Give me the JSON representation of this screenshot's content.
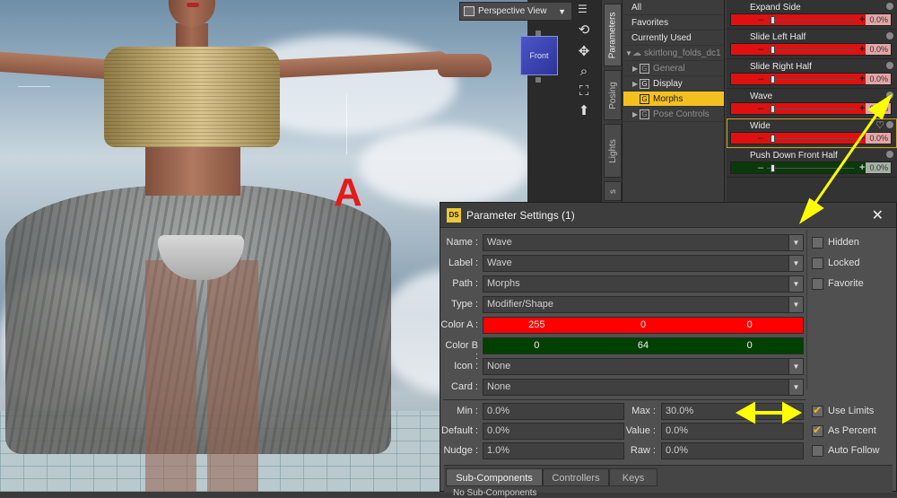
{
  "viewport": {
    "view_label": "Perspective View",
    "cube_label": "Front",
    "annotation_letter": "A"
  },
  "tabs": [
    "Parameters",
    "Posing",
    "Lights",
    "s"
  ],
  "tree": {
    "items": [
      {
        "label": "All"
      },
      {
        "label": "Favorites"
      },
      {
        "label": "Currently Used"
      },
      {
        "label": "skirtlong_folds_dc1"
      },
      {
        "label": "General"
      },
      {
        "label": "Display"
      },
      {
        "label": "Morphs"
      },
      {
        "label": "Pose Controls"
      }
    ]
  },
  "sliders": [
    {
      "label": "Expand Side",
      "value": "0.0%",
      "color": "#e01010"
    },
    {
      "label": "Slide Left Half",
      "value": "0.0%",
      "color": "#e01010"
    },
    {
      "label": "Slide Right Half",
      "value": "0.0%",
      "color": "#e01010"
    },
    {
      "label": "Wave",
      "value": "0.0%",
      "color": "#e01010"
    },
    {
      "label": "Wide",
      "value": "0.0%",
      "color": "#e01010"
    },
    {
      "label": "Push Down Front Half",
      "value": "0.0%",
      "color": "#0a3a0a"
    }
  ],
  "dialog": {
    "title": "Parameter Settings (1)",
    "logo": "DS",
    "fields": {
      "name_label": "Name :",
      "name_value": "Wave",
      "label_label": "Label :",
      "label_value": "Wave",
      "path_label": "Path :",
      "path_value": "Morphs",
      "type_label": "Type :",
      "type_value": "Modifier/Shape",
      "color_a_label": "Color A :",
      "color_a": [
        "255",
        "0",
        "0"
      ],
      "color_b_label": "Color B :",
      "color_b": [
        "0",
        "64",
        "0"
      ],
      "icon_label": "Icon :",
      "icon_value": "None",
      "card_label": "Card :",
      "card_value": "None",
      "min_label": "Min :",
      "min_value": "0.0%",
      "max_label": "Max :",
      "max_value": "30.0%",
      "default_label": "Default :",
      "default_value": "0.0%",
      "value_label": "Value :",
      "value_value": "0.0%",
      "nudge_label": "Nudge :",
      "nudge_value": "1.0%",
      "raw_label": "Raw :",
      "raw_value": "0.0%"
    },
    "checkboxes": {
      "hidden": "Hidden",
      "locked": "Locked",
      "favorite": "Favorite",
      "use_limits": "Use Limits",
      "as_percent": "As Percent",
      "auto_follow": "Auto Follow"
    },
    "subtabs": [
      "Sub-Components",
      "Controllers",
      "Keys"
    ],
    "subtab_text": "No Sub-Components"
  },
  "colors": {
    "color_a": "#ff0000",
    "color_b": "#004000",
    "selection": "#f4c020",
    "annotation": "#ffff00"
  }
}
